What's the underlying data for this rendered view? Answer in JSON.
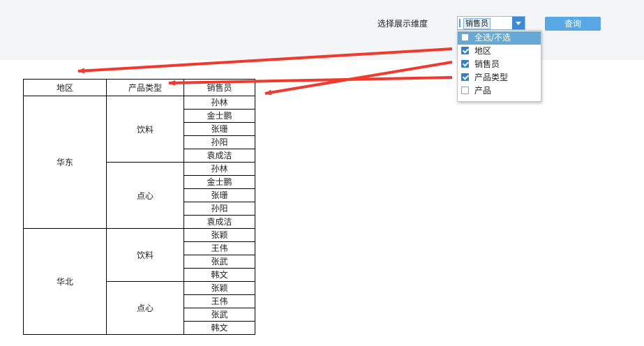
{
  "toolbar": {
    "dimension_label": "选择展示维度",
    "selected_tag": "销售员",
    "query_label": "查询"
  },
  "dropdown": {
    "options": [
      {
        "label": "全选/不选",
        "checked": false
      },
      {
        "label": "地区",
        "checked": true
      },
      {
        "label": "销售员",
        "checked": true
      },
      {
        "label": "产品类型",
        "checked": true
      },
      {
        "label": "产品",
        "checked": false
      }
    ]
  },
  "table": {
    "headers": [
      "地区",
      "产品类型",
      "销售员"
    ],
    "regions": [
      {
        "name": "华东",
        "groups": [
          {
            "type": "饮料",
            "people": [
              "孙林",
              "金士鹏",
              "张珊",
              "孙阳",
              "袁成洁"
            ]
          },
          {
            "type": "点心",
            "people": [
              "孙林",
              "金士鹏",
              "张珊",
              "孙阳",
              "袁成洁"
            ]
          }
        ]
      },
      {
        "name": "华北",
        "groups": [
          {
            "type": "饮料",
            "people": [
              "张颖",
              "王伟",
              "张武",
              "韩文"
            ]
          },
          {
            "type": "点心",
            "people": [
              "张颖",
              "王伟",
              "张武",
              "韩文"
            ]
          }
        ]
      }
    ]
  },
  "colors": {
    "arrow": "#f03a2e",
    "accent": "#2f82cf",
    "button": "#5aa7e6"
  }
}
